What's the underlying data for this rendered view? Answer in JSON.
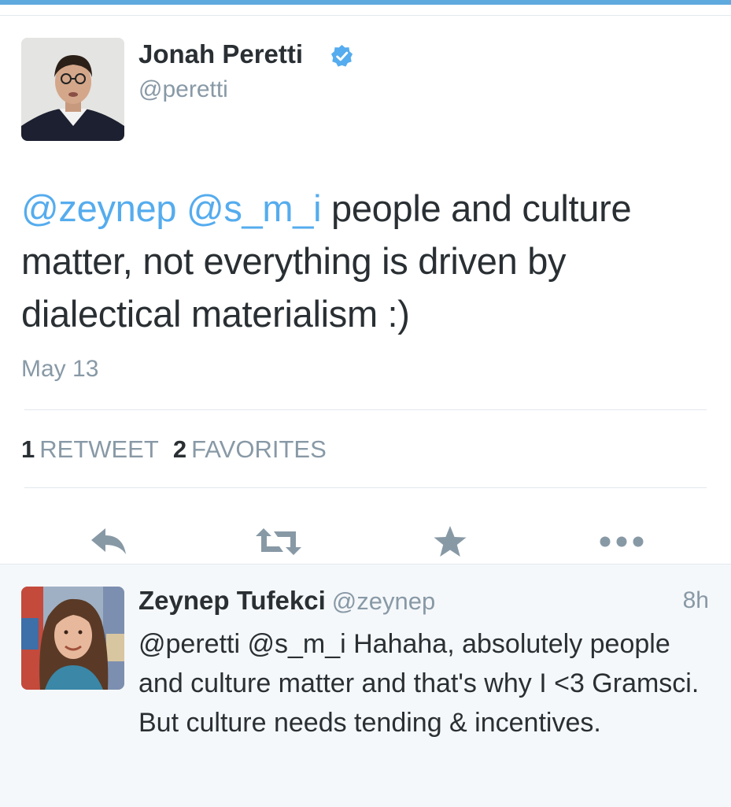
{
  "main_tweet": {
    "author_name": "Jonah Peretti",
    "author_handle": "@peretti",
    "verified": true,
    "mentions": [
      "@zeynep",
      "@s_m_i"
    ],
    "text": "people and culture matter, not everything is driven by dialectical materialism :)",
    "date": "May 13",
    "retweet_count": "1",
    "retweet_label": "RETWEET",
    "favorite_count": "2",
    "favorite_label": "FAVORITES"
  },
  "actions": {
    "reply_icon": "reply-icon",
    "retweet_icon": "retweet-icon",
    "favorite_icon": "star-icon",
    "more_icon": "more-icon"
  },
  "reply_tweet": {
    "author_name": "Zeynep Tufekci",
    "author_handle": "@zeynep",
    "time": "8h",
    "text": "@peretti @s_m_i Hahaha, absolutely people and culture matter and that's why I <3 Gramsci. But culture needs tending & incentives."
  },
  "colors": {
    "accent": "#55acee",
    "muted": "#8899a6",
    "text": "#292f33",
    "icon": "#8899a6",
    "reply_background": "#f5f8fa"
  }
}
